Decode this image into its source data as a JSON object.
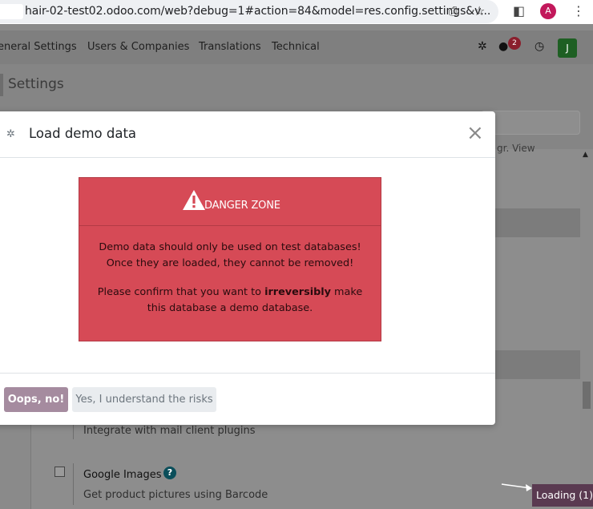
{
  "browser": {
    "url": "hair-02-test02.odoo.com/web?debug=1#action=84&model=res.config.settings&v...",
    "avatar_letter": "A"
  },
  "navbar": {
    "items": [
      "eneral Settings",
      "Users & Companies",
      "Translations",
      "Technical"
    ],
    "chat_count": "2",
    "user_initial": "J"
  },
  "breadcrumb": "Settings",
  "background": {
    "fragment_top": "gr. View",
    "setting_desc_1": "Integrate with mail client plugins",
    "setting_title_2": "Google Images",
    "setting_desc_2": "Get product pictures using Barcode"
  },
  "loading": "Loading (1)",
  "modal": {
    "title": "Load demo data",
    "danger_title": "DANGER ZONE",
    "paragraph1": "Demo data should only be used on test databases! Once they are loaded, they cannot be removed!",
    "paragraph2_before": "Please confirm that you want to ",
    "paragraph2_bold": "irreversibly",
    "paragraph2_after": " make this database a demo database.",
    "btn_cancel": "Oops, no!",
    "btn_confirm": "Yes, I understand the risks"
  },
  "colors": {
    "danger": "#d64a56",
    "primary_dimmed": "#a58b9f",
    "loading_bg": "#5a3a51"
  }
}
